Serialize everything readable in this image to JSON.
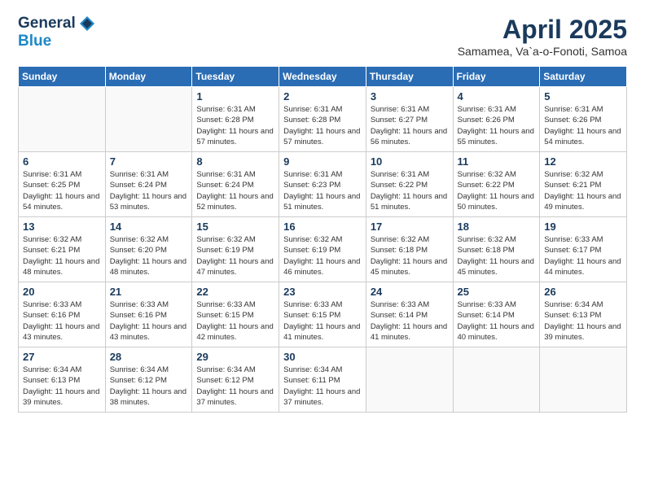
{
  "header": {
    "logo_general": "General",
    "logo_blue": "Blue",
    "title": "April 2025",
    "subtitle": "Samamea, Va`a-o-Fonoti, Samoa"
  },
  "days_of_week": [
    "Sunday",
    "Monday",
    "Tuesday",
    "Wednesday",
    "Thursday",
    "Friday",
    "Saturday"
  ],
  "weeks": [
    [
      {
        "day": "",
        "content": ""
      },
      {
        "day": "",
        "content": ""
      },
      {
        "day": "1",
        "content": "Sunrise: 6:31 AM\nSunset: 6:28 PM\nDaylight: 11 hours and 57 minutes."
      },
      {
        "day": "2",
        "content": "Sunrise: 6:31 AM\nSunset: 6:28 PM\nDaylight: 11 hours and 57 minutes."
      },
      {
        "day": "3",
        "content": "Sunrise: 6:31 AM\nSunset: 6:27 PM\nDaylight: 11 hours and 56 minutes."
      },
      {
        "day": "4",
        "content": "Sunrise: 6:31 AM\nSunset: 6:26 PM\nDaylight: 11 hours and 55 minutes."
      },
      {
        "day": "5",
        "content": "Sunrise: 6:31 AM\nSunset: 6:26 PM\nDaylight: 11 hours and 54 minutes."
      }
    ],
    [
      {
        "day": "6",
        "content": "Sunrise: 6:31 AM\nSunset: 6:25 PM\nDaylight: 11 hours and 54 minutes."
      },
      {
        "day": "7",
        "content": "Sunrise: 6:31 AM\nSunset: 6:24 PM\nDaylight: 11 hours and 53 minutes."
      },
      {
        "day": "8",
        "content": "Sunrise: 6:31 AM\nSunset: 6:24 PM\nDaylight: 11 hours and 52 minutes."
      },
      {
        "day": "9",
        "content": "Sunrise: 6:31 AM\nSunset: 6:23 PM\nDaylight: 11 hours and 51 minutes."
      },
      {
        "day": "10",
        "content": "Sunrise: 6:31 AM\nSunset: 6:22 PM\nDaylight: 11 hours and 51 minutes."
      },
      {
        "day": "11",
        "content": "Sunrise: 6:32 AM\nSunset: 6:22 PM\nDaylight: 11 hours and 50 minutes."
      },
      {
        "day": "12",
        "content": "Sunrise: 6:32 AM\nSunset: 6:21 PM\nDaylight: 11 hours and 49 minutes."
      }
    ],
    [
      {
        "day": "13",
        "content": "Sunrise: 6:32 AM\nSunset: 6:21 PM\nDaylight: 11 hours and 48 minutes."
      },
      {
        "day": "14",
        "content": "Sunrise: 6:32 AM\nSunset: 6:20 PM\nDaylight: 11 hours and 48 minutes."
      },
      {
        "day": "15",
        "content": "Sunrise: 6:32 AM\nSunset: 6:19 PM\nDaylight: 11 hours and 47 minutes."
      },
      {
        "day": "16",
        "content": "Sunrise: 6:32 AM\nSunset: 6:19 PM\nDaylight: 11 hours and 46 minutes."
      },
      {
        "day": "17",
        "content": "Sunrise: 6:32 AM\nSunset: 6:18 PM\nDaylight: 11 hours and 45 minutes."
      },
      {
        "day": "18",
        "content": "Sunrise: 6:32 AM\nSunset: 6:18 PM\nDaylight: 11 hours and 45 minutes."
      },
      {
        "day": "19",
        "content": "Sunrise: 6:33 AM\nSunset: 6:17 PM\nDaylight: 11 hours and 44 minutes."
      }
    ],
    [
      {
        "day": "20",
        "content": "Sunrise: 6:33 AM\nSunset: 6:16 PM\nDaylight: 11 hours and 43 minutes."
      },
      {
        "day": "21",
        "content": "Sunrise: 6:33 AM\nSunset: 6:16 PM\nDaylight: 11 hours and 43 minutes."
      },
      {
        "day": "22",
        "content": "Sunrise: 6:33 AM\nSunset: 6:15 PM\nDaylight: 11 hours and 42 minutes."
      },
      {
        "day": "23",
        "content": "Sunrise: 6:33 AM\nSunset: 6:15 PM\nDaylight: 11 hours and 41 minutes."
      },
      {
        "day": "24",
        "content": "Sunrise: 6:33 AM\nSunset: 6:14 PM\nDaylight: 11 hours and 41 minutes."
      },
      {
        "day": "25",
        "content": "Sunrise: 6:33 AM\nSunset: 6:14 PM\nDaylight: 11 hours and 40 minutes."
      },
      {
        "day": "26",
        "content": "Sunrise: 6:34 AM\nSunset: 6:13 PM\nDaylight: 11 hours and 39 minutes."
      }
    ],
    [
      {
        "day": "27",
        "content": "Sunrise: 6:34 AM\nSunset: 6:13 PM\nDaylight: 11 hours and 39 minutes."
      },
      {
        "day": "28",
        "content": "Sunrise: 6:34 AM\nSunset: 6:12 PM\nDaylight: 11 hours and 38 minutes."
      },
      {
        "day": "29",
        "content": "Sunrise: 6:34 AM\nSunset: 6:12 PM\nDaylight: 11 hours and 37 minutes."
      },
      {
        "day": "30",
        "content": "Sunrise: 6:34 AM\nSunset: 6:11 PM\nDaylight: 11 hours and 37 minutes."
      },
      {
        "day": "",
        "content": ""
      },
      {
        "day": "",
        "content": ""
      },
      {
        "day": "",
        "content": ""
      }
    ]
  ]
}
